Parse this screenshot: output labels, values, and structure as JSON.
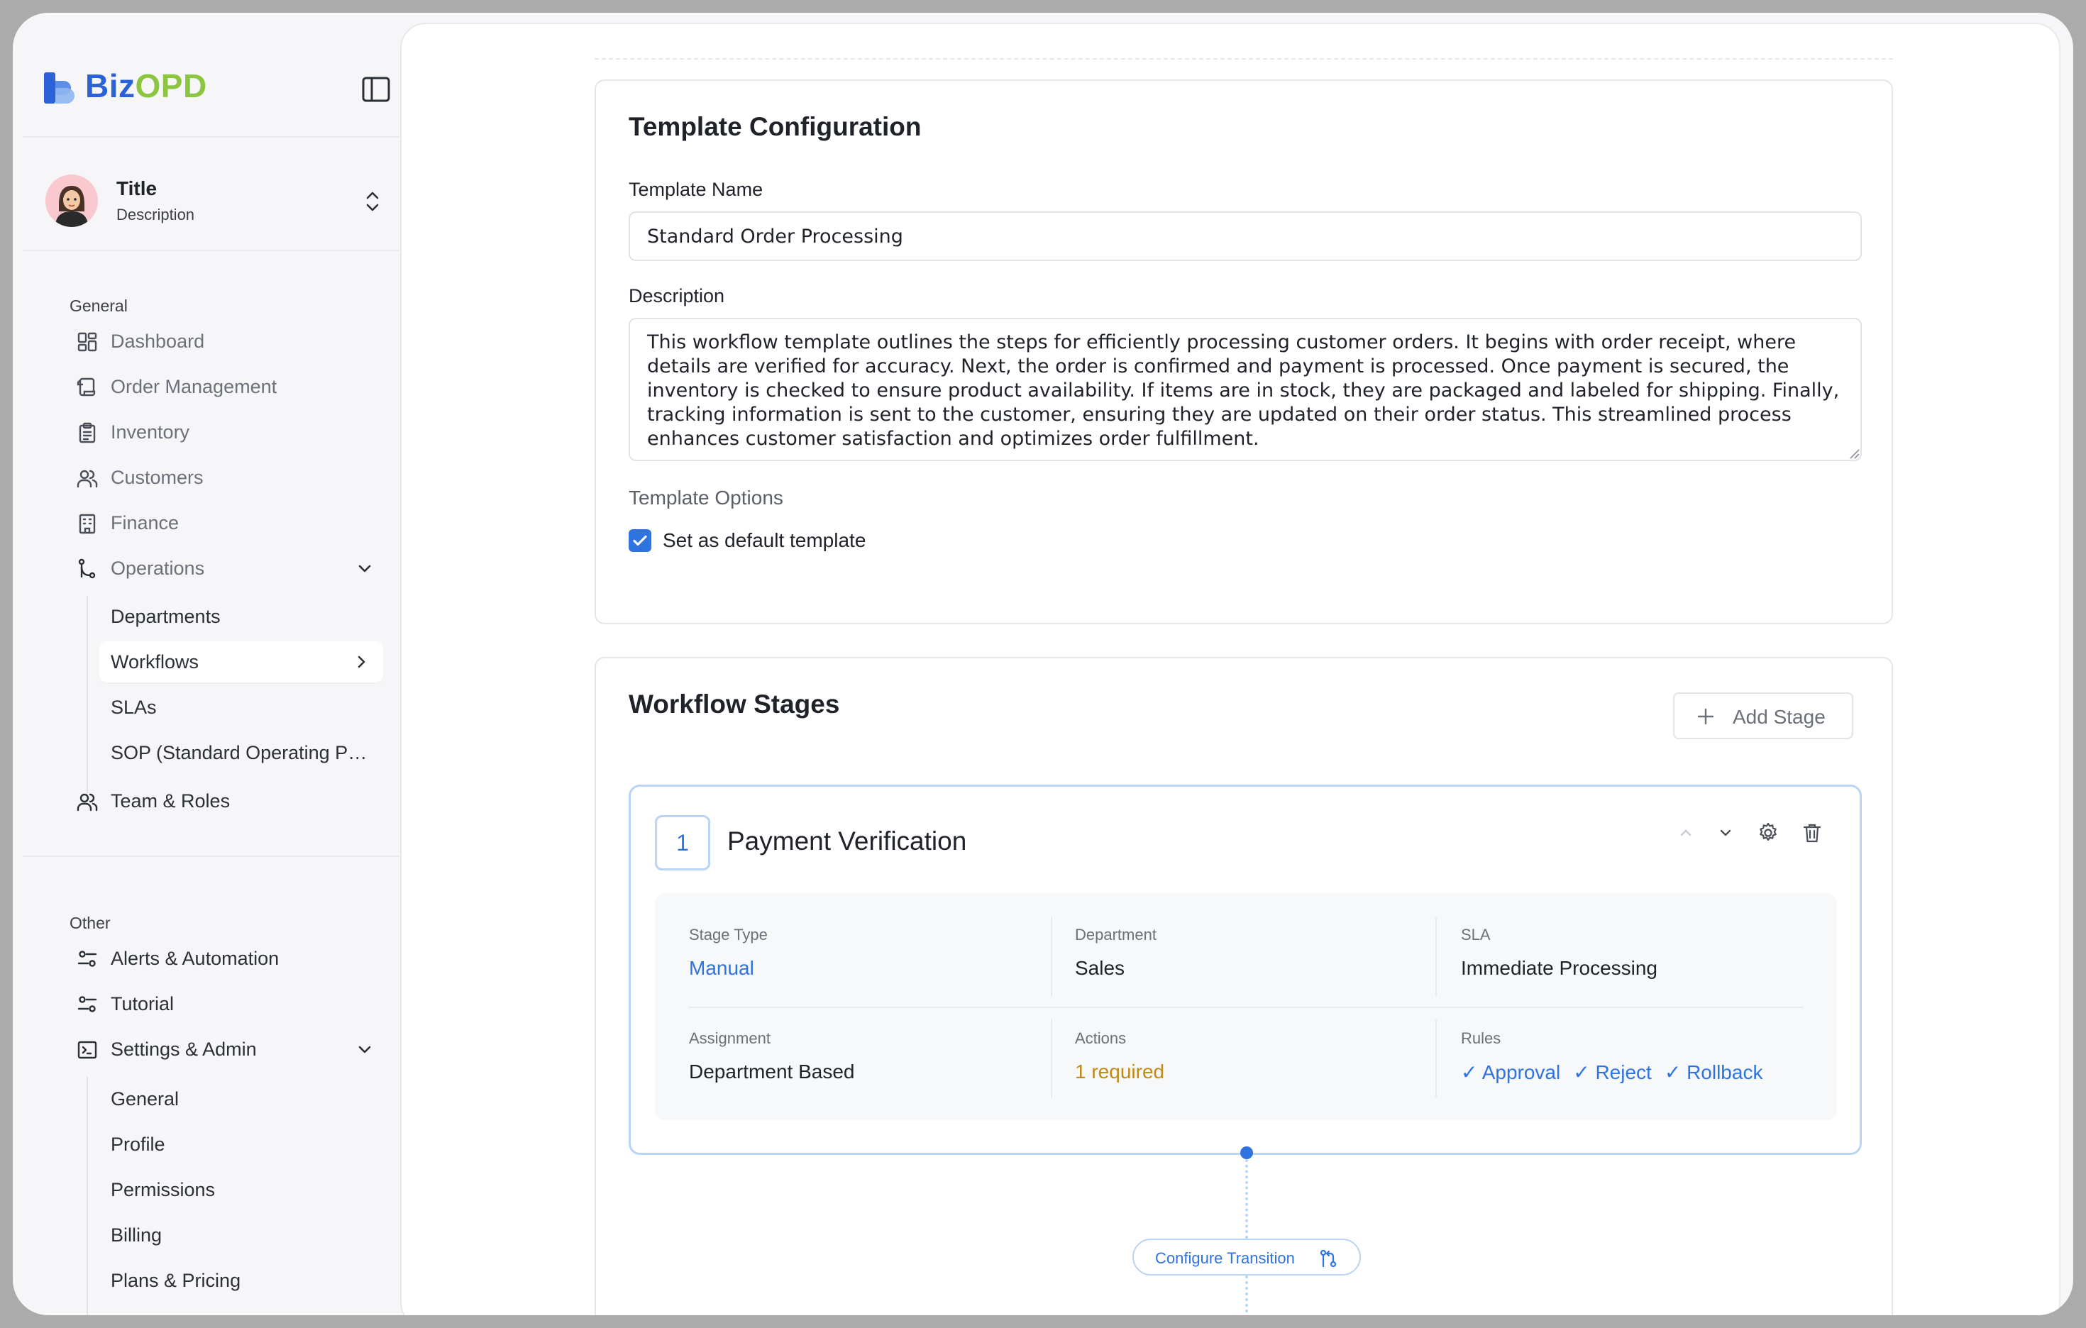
{
  "brand": {
    "name_part1": "Biz",
    "name_part2": "OPD"
  },
  "profile": {
    "title": "Title",
    "description": "Description"
  },
  "sidebar": {
    "general_label": "General",
    "general_items": [
      {
        "label": "Dashboard",
        "icon": "dashboard-icon"
      },
      {
        "label": "Order Management",
        "icon": "scroll-icon"
      },
      {
        "label": "Inventory",
        "icon": "clipboard-icon"
      },
      {
        "label": "Customers",
        "icon": "users-icon"
      },
      {
        "label": "Finance",
        "icon": "building-icon"
      },
      {
        "label": "Operations",
        "icon": "git-branch-icon"
      }
    ],
    "operations_subitems": [
      {
        "label": "Departments"
      },
      {
        "label": "Workflows"
      },
      {
        "label": "SLAs"
      },
      {
        "label": "SOP (Standard Operating Procedures)"
      }
    ],
    "team_roles": "Team & Roles",
    "other_label": "Other",
    "other_items": [
      {
        "label": "Alerts & Automation",
        "icon": "sliders-icon"
      },
      {
        "label": "Tutorial",
        "icon": "sliders-icon"
      },
      {
        "label": "Settings & Admin",
        "icon": "terminal-icon"
      }
    ],
    "settings_subitems": [
      {
        "label": "General"
      },
      {
        "label": "Profile"
      },
      {
        "label": "Permissions"
      },
      {
        "label": "Billing"
      },
      {
        "label": "Plans & Pricing"
      }
    ]
  },
  "template": {
    "section_title": "Template Configuration",
    "name_label": "Template Name",
    "name_value": "Standard Order Processing",
    "description_label": "Description",
    "description_value": "This workflow template outlines the steps for efficiently processing customer orders. It begins with order receipt, where details are verified for accuracy. Next, the order is confirmed and payment is processed. Once payment is secured, the inventory is checked to ensure product availability. If items are in stock, they are packaged and labeled for shipping. Finally, tracking information is sent to the customer, ensuring they are updated on their order status. This streamlined process enhances customer satisfaction and optimizes order fulfillment.",
    "options_label": "Template Options",
    "default_checkbox_label": "Set as default template",
    "default_checked": true
  },
  "workflow": {
    "section_title": "Workflow Stages",
    "add_stage_label": "Add Stage",
    "stages": [
      {
        "number": "1",
        "name": "Payment Verification",
        "stage_type_label": "Stage Type",
        "stage_type": "Manual",
        "department_label": "Department",
        "department": "Sales",
        "sla_label": "SLA",
        "sla": "Immediate Processing",
        "assignment_label": "Assignment",
        "assignment": "Department Based",
        "actions_label": "Actions",
        "actions": "1 required",
        "rules_label": "Rules",
        "rules": [
          "✓ Approval",
          "✓ Reject",
          "✓ Rollback"
        ]
      }
    ],
    "transition_label": "Configure Transition"
  },
  "colors": {
    "accent": "#2f73e0",
    "brand_blue": "#2b62d8",
    "brand_green": "#8cc640",
    "amber": "#c08a12"
  }
}
